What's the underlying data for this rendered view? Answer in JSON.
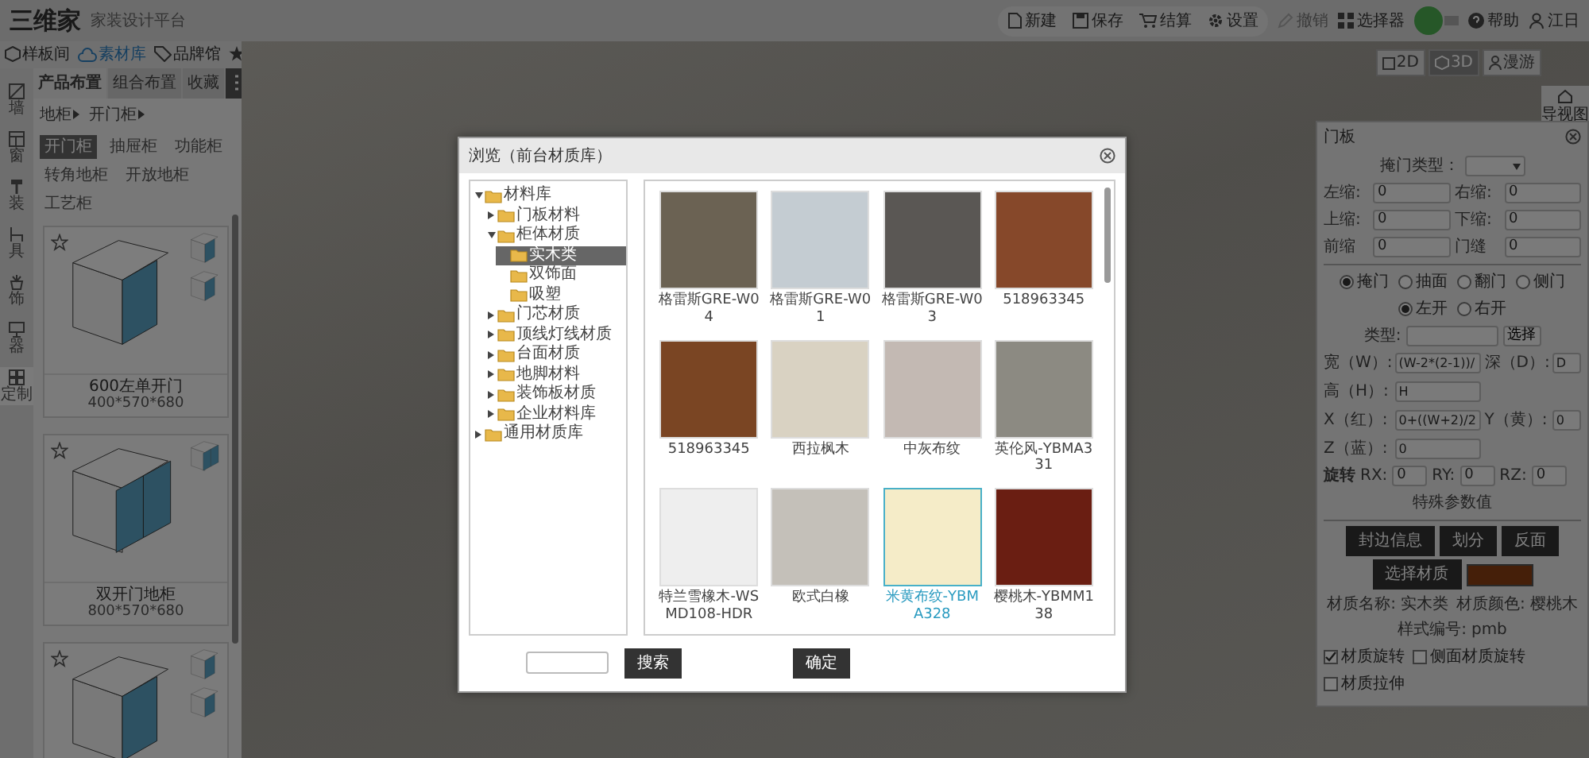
{
  "top_bar": {
    "logo": "三维家",
    "subtitle": "家装设计平台",
    "actions": [
      {
        "label": "新建"
      },
      {
        "label": "保存"
      },
      {
        "label": "结算"
      },
      {
        "label": "设置"
      }
    ],
    "tools": [
      {
        "label": "撤销",
        "disabled": true
      },
      {
        "label": "选择器",
        "disabled": false
      }
    ],
    "help": "帮助",
    "user": "江日"
  },
  "library_tabs": [
    {
      "label": "样板间",
      "selected": false
    },
    {
      "label": "素材库",
      "selected": true
    },
    {
      "label": "品牌馆",
      "selected": false
    }
  ],
  "side_rail": [
    {
      "label": "墙",
      "selected": false
    },
    {
      "label": "窗",
      "selected": false
    },
    {
      "label": "装",
      "selected": false
    },
    {
      "label": "具",
      "selected": false
    },
    {
      "label": "饰",
      "selected": false
    },
    {
      "label": "器",
      "selected": false
    },
    {
      "label": "定制",
      "selected": true
    }
  ],
  "layout_tabs": [
    {
      "label": "产品布置",
      "selected": true
    },
    {
      "label": "组合布置",
      "selected": false
    },
    {
      "label": "收藏",
      "selected": false
    }
  ],
  "breadcrumb": [
    "地柜",
    "开门柜"
  ],
  "categories": [
    {
      "label": "开门柜",
      "selected": true
    },
    {
      "label": "抽屉柜",
      "selected": false
    },
    {
      "label": "功能柜",
      "selected": false
    },
    {
      "label": "转角地柜",
      "selected": false
    },
    {
      "label": "开放地柜",
      "selected": false
    },
    {
      "label": "工艺柜",
      "selected": false
    }
  ],
  "products": [
    {
      "kind": "single",
      "name": "600左单开门",
      "size": "400*570*680"
    },
    {
      "kind": "double",
      "name": "双开门地柜",
      "size": "800*570*680"
    },
    {
      "kind": "single"
    }
  ],
  "view_modes": [
    {
      "label": "2D",
      "selected": false
    },
    {
      "label": "3D",
      "selected": true
    },
    {
      "label": "漫游",
      "selected": false
    }
  ],
  "guide_button": "导视图",
  "modal": {
    "title": "浏览（前台材质库）",
    "tree": [
      {
        "label": "材料库",
        "expanded": true,
        "selected": false,
        "children": [
          {
            "label": "门板材料",
            "expanded": false,
            "selected": false
          },
          {
            "label": "柜体材质",
            "expanded": true,
            "selected": false,
            "children": [
              {
                "label": "实木类",
                "selected": true
              },
              {
                "label": "双饰面",
                "selected": false
              },
              {
                "label": "吸塑",
                "selected": false
              }
            ]
          },
          {
            "label": "门芯材质",
            "expanded": false,
            "selected": false
          },
          {
            "label": "顶线灯线材质",
            "expanded": false,
            "selected": false
          },
          {
            "label": "台面材质",
            "expanded": false,
            "selected": false
          },
          {
            "label": "地脚材料",
            "expanded": false,
            "selected": false
          },
          {
            "label": "装饰板材质",
            "expanded": false,
            "selected": false
          },
          {
            "label": "企业材料库",
            "expanded": false,
            "selected": false
          }
        ]
      },
      {
        "label": "通用材质库",
        "expanded": false,
        "selected": false
      }
    ],
    "materials": [
      {
        "name": "格雷斯GRE-W04",
        "color": "#6b6253",
        "selected": false
      },
      {
        "name": "格雷斯GRE-W01",
        "color": "#c4ccd2",
        "selected": false
      },
      {
        "name": "格雷斯GRE-W03",
        "color": "#5a5754",
        "selected": false
      },
      {
        "name": "518963345",
        "color": "#86482a",
        "selected": false
      },
      {
        "name": "518963345",
        "color": "#7a4523",
        "selected": false
      },
      {
        "name": "西拉枫木",
        "color": "#d9d2c2",
        "selected": false
      },
      {
        "name": "中灰布纹",
        "color": "#c3b9b3",
        "selected": false
      },
      {
        "name": "英伦风-YBMA331",
        "color": "#8c8a82",
        "selected": false
      },
      {
        "name": "特兰雪橡木-WSMD108-HDR",
        "color": "#eeeeee",
        "selected": false
      },
      {
        "name": "欧式白橡",
        "color": "#c4c0b9",
        "selected": false
      },
      {
        "name": "米黄布纹-YBMA328",
        "color": "#f5ecc8",
        "selected": true
      },
      {
        "name": "樱桃木-YBMM138",
        "color": "#6a1e12",
        "selected": false
      }
    ],
    "search_button": "搜索",
    "confirm_button": "确定"
  },
  "door_panel": {
    "title": "门板",
    "type_label": "掩门类型：",
    "offsets": [
      {
        "label": "左缩:",
        "value": "0"
      },
      {
        "label": "右缩:",
        "value": "0"
      },
      {
        "label": "上缩:",
        "value": "0"
      },
      {
        "label": "下缩:",
        "value": "0"
      },
      {
        "label": "前缩",
        "value": "0"
      },
      {
        "label": "门缝",
        "value": "0"
      }
    ],
    "door_types": [
      {
        "label": "掩门",
        "selected": true
      },
      {
        "label": "抽面",
        "selected": false
      },
      {
        "label": "翻门",
        "selected": false
      },
      {
        "label": "侧门",
        "selected": false
      }
    ],
    "directions": [
      {
        "label": "左开",
        "selected": true
      },
      {
        "label": "右开",
        "selected": false
      }
    ],
    "kind_label": "类型:",
    "choose_button": "选择",
    "param_rows": [
      [
        {
          "label": "宽（W）:",
          "value": "(W-2*(2-1))/"
        },
        {
          "label": "深（D）:",
          "value": "D"
        }
      ],
      [
        {
          "label": "高（H）:",
          "value": "H"
        }
      ],
      [
        {
          "label": "X（红）:",
          "value": "0+((W+2)/2"
        },
        {
          "label": "Y（黄）:",
          "value": "0"
        }
      ],
      [
        {
          "label": "Z（蓝）:",
          "value": "0"
        }
      ]
    ],
    "rotation_label": "旋转",
    "rotations": [
      {
        "label": "RX:",
        "value": "0"
      },
      {
        "label": "RY:",
        "value": "0"
      },
      {
        "label": "RZ:",
        "value": "0"
      }
    ],
    "special_label": "特殊参数值",
    "buttons": [
      "封边信息",
      "划分",
      "反面"
    ],
    "material_button": "选择材质",
    "info": [
      {
        "label": "材质名称:",
        "value": "实木类"
      },
      {
        "label": "材质颜色:",
        "value": "樱桃木"
      },
      {
        "label": "样式编号:",
        "value": "pmb"
      }
    ],
    "options": [
      {
        "label": "材质旋转",
        "checked": true
      },
      {
        "label": "侧面材质旋转",
        "checked": false
      },
      {
        "label": "材质拉伸",
        "checked": false
      }
    ]
  }
}
